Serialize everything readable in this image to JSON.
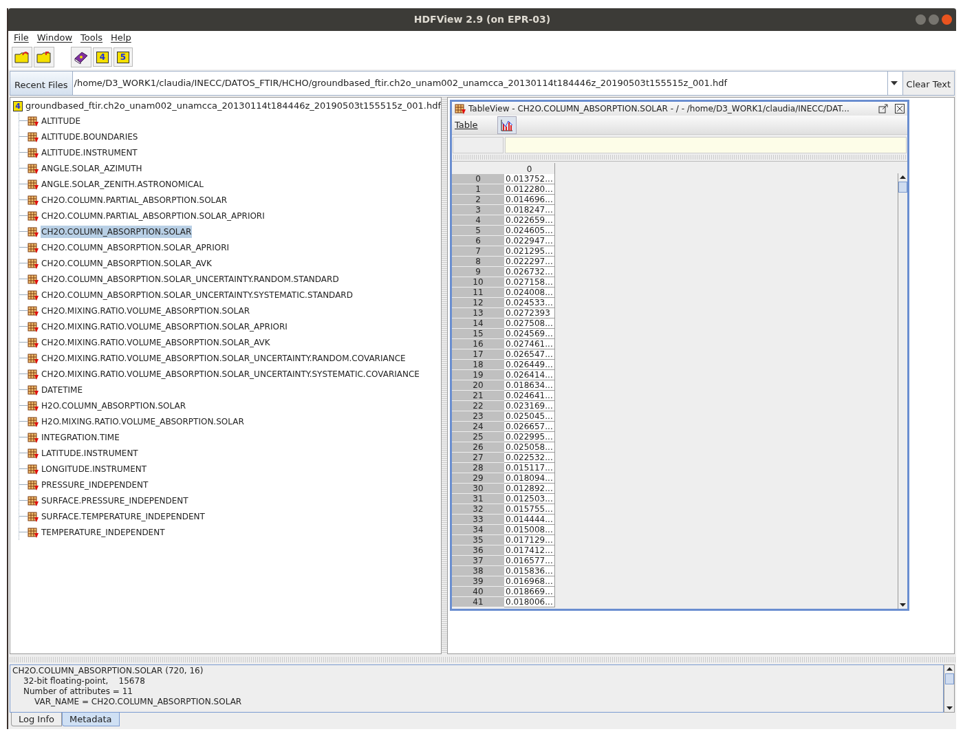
{
  "window": {
    "title": "HDFView 2.9 (on EPR-03)"
  },
  "menu": [
    "File",
    "Window",
    "Tools",
    "Help"
  ],
  "recent_files": {
    "label": "Recent Files",
    "value": "/home/D3_WORK1/claudia/INECC/DATOS_FTIR/HCHO/groundbased_ftir.ch2o_unam002_unamcca_20130114t184446z_20190503t155515z_001.hdf",
    "clear": "Clear Text"
  },
  "toolbar_badges": [
    "4",
    "5"
  ],
  "tree": {
    "badge": "4",
    "root": "groundbased_ftir.ch2o_unam002_unamcca_20130114t184446z_20190503t155515z_001.hdf",
    "items": [
      {
        "label": "ALTITUDE",
        "selected": false
      },
      {
        "label": "ALTITUDE.BOUNDARIES",
        "selected": false
      },
      {
        "label": "ALTITUDE.INSTRUMENT",
        "selected": false
      },
      {
        "label": "ANGLE.SOLAR_AZIMUTH",
        "selected": false
      },
      {
        "label": "ANGLE.SOLAR_ZENITH.ASTRONOMICAL",
        "selected": false
      },
      {
        "label": "CH2O.COLUMN.PARTIAL_ABSORPTION.SOLAR",
        "selected": false
      },
      {
        "label": "CH2O.COLUMN.PARTIAL_ABSORPTION.SOLAR_APRIORI",
        "selected": false
      },
      {
        "label": "CH2O.COLUMN_ABSORPTION.SOLAR",
        "selected": true
      },
      {
        "label": "CH2O.COLUMN_ABSORPTION.SOLAR_APRIORI",
        "selected": false
      },
      {
        "label": "CH2O.COLUMN_ABSORPTION.SOLAR_AVK",
        "selected": false
      },
      {
        "label": "CH2O.COLUMN_ABSORPTION.SOLAR_UNCERTAINTY.RANDOM.STANDARD",
        "selected": false
      },
      {
        "label": "CH2O.COLUMN_ABSORPTION.SOLAR_UNCERTAINTY.SYSTEMATIC.STANDARD",
        "selected": false
      },
      {
        "label": "CH2O.MIXING.RATIO.VOLUME_ABSORPTION.SOLAR",
        "selected": false
      },
      {
        "label": "CH2O.MIXING.RATIO.VOLUME_ABSORPTION.SOLAR_APRIORI",
        "selected": false
      },
      {
        "label": "CH2O.MIXING.RATIO.VOLUME_ABSORPTION.SOLAR_AVK",
        "selected": false
      },
      {
        "label": "CH2O.MIXING.RATIO.VOLUME_ABSORPTION.SOLAR_UNCERTAINTY.RANDOM.COVARIANCE",
        "selected": false
      },
      {
        "label": "CH2O.MIXING.RATIO.VOLUME_ABSORPTION.SOLAR_UNCERTAINTY.SYSTEMATIC.COVARIANCE",
        "selected": false
      },
      {
        "label": "DATETIME",
        "selected": false
      },
      {
        "label": "H2O.COLUMN_ABSORPTION.SOLAR",
        "selected": false
      },
      {
        "label": "H2O.MIXING.RATIO.VOLUME_ABSORPTION.SOLAR",
        "selected": false
      },
      {
        "label": "INTEGRATION.TIME",
        "selected": false
      },
      {
        "label": "LATITUDE.INSTRUMENT",
        "selected": false
      },
      {
        "label": "LONGITUDE.INSTRUMENT",
        "selected": false
      },
      {
        "label": "PRESSURE_INDEPENDENT",
        "selected": false
      },
      {
        "label": "SURFACE.PRESSURE_INDEPENDENT",
        "selected": false
      },
      {
        "label": "SURFACE.TEMPERATURE_INDEPENDENT",
        "selected": false
      },
      {
        "label": "TEMPERATURE_INDEPENDENT",
        "selected": false
      }
    ]
  },
  "table_view": {
    "title": "TableView  -  CH2O.COLUMN_ABSORPTION.SOLAR  -  /  -  /home/D3_WORK1/claudia/INECC/DAT...",
    "menu": "Table",
    "column": "0",
    "rows": [
      [
        "0",
        "0.013752..."
      ],
      [
        "1",
        "0.012280..."
      ],
      [
        "2",
        "0.014696..."
      ],
      [
        "3",
        "0.018247..."
      ],
      [
        "4",
        "0.022659..."
      ],
      [
        "5",
        "0.024605..."
      ],
      [
        "6",
        "0.022947..."
      ],
      [
        "7",
        "0.021295..."
      ],
      [
        "8",
        "0.022297..."
      ],
      [
        "9",
        "0.026732..."
      ],
      [
        "10",
        "0.027158..."
      ],
      [
        "11",
        "0.024008..."
      ],
      [
        "12",
        "0.024533..."
      ],
      [
        "13",
        "0.0272393"
      ],
      [
        "14",
        "0.027508..."
      ],
      [
        "15",
        "0.024569..."
      ],
      [
        "16",
        "0.027461..."
      ],
      [
        "17",
        "0.026547..."
      ],
      [
        "18",
        "0.026449..."
      ],
      [
        "19",
        "0.026414..."
      ],
      [
        "20",
        "0.018634..."
      ],
      [
        "21",
        "0.024641..."
      ],
      [
        "22",
        "0.023169..."
      ],
      [
        "23",
        "0.025045..."
      ],
      [
        "24",
        "0.026657..."
      ],
      [
        "25",
        "0.022995..."
      ],
      [
        "26",
        "0.025058..."
      ],
      [
        "27",
        "0.022532..."
      ],
      [
        "28",
        "0.015117..."
      ],
      [
        "29",
        "0.018094..."
      ],
      [
        "30",
        "0.012892..."
      ],
      [
        "31",
        "0.012503..."
      ],
      [
        "32",
        "0.015755..."
      ],
      [
        "33",
        "0.014444..."
      ],
      [
        "34",
        "0.015008..."
      ],
      [
        "35",
        "0.017129..."
      ],
      [
        "36",
        "0.017412..."
      ],
      [
        "37",
        "0.016577..."
      ],
      [
        "38",
        "0.015836..."
      ],
      [
        "39",
        "0.016968..."
      ],
      [
        "40",
        "0.018669..."
      ],
      [
        "41",
        "0.018006..."
      ]
    ]
  },
  "info": {
    "lines": [
      "CH2O.COLUMN_ABSORPTION.SOLAR (720, 16)",
      "32-bit floating-point,    15678",
      "Number of attributes = 11",
      "VAR_NAME = CH2O.COLUMN_ABSORPTION.SOLAR"
    ]
  },
  "tabs": [
    {
      "label": "Log Info",
      "selected": false
    },
    {
      "label": "Metadata",
      "selected": true
    }
  ]
}
